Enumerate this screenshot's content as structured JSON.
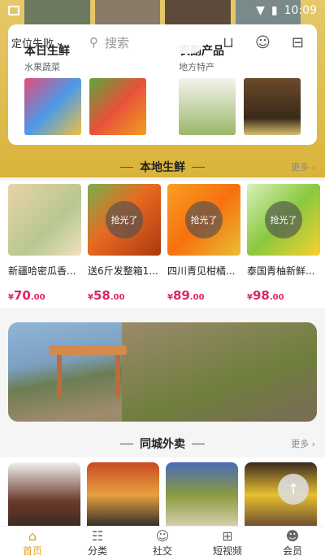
{
  "status": {
    "time": "10:09"
  },
  "header": {
    "location_label": "定位失败",
    "search_placeholder": "搜索",
    "icons": [
      "cart-icon",
      "message-icon",
      "scan-icon"
    ]
  },
  "categories": [
    {
      "title": "本日生鲜",
      "subtitle": "水果蔬菜"
    },
    {
      "title": "农副产品",
      "subtitle": "地方特产"
    }
  ],
  "section_fresh": {
    "title": "本地生鲜",
    "more": "更多"
  },
  "products": [
    {
      "name": "新疆哈密瓜香...",
      "currency": "¥",
      "price_int": "70",
      "price_dec": ".00",
      "soldout": ""
    },
    {
      "name": "送6斤发整箱1...",
      "currency": "¥",
      "price_int": "58",
      "price_dec": ".00",
      "soldout": "抢光了"
    },
    {
      "name": "四川青见柑橘...",
      "currency": "¥",
      "price_int": "89",
      "price_dec": ".00",
      "soldout": "抢光了"
    },
    {
      "name": "泰国青柚新鲜...",
      "currency": "¥",
      "price_int": "98",
      "price_dec": ".00",
      "soldout": "抢光了"
    }
  ],
  "section_takeaway": {
    "title": "同城外卖",
    "more": "更多"
  },
  "nav": [
    {
      "label": "首页",
      "icon": "home-icon",
      "active": true
    },
    {
      "label": "分类",
      "icon": "category-icon",
      "active": false
    },
    {
      "label": "社交",
      "icon": "social-icon",
      "active": false
    },
    {
      "label": "短视频",
      "icon": "video-icon",
      "active": false
    },
    {
      "label": "会员",
      "icon": "member-icon",
      "active": false
    }
  ],
  "colors": {
    "accent": "#e0a020",
    "price": "#e0245e",
    "header_gold": "#d9b43a"
  }
}
